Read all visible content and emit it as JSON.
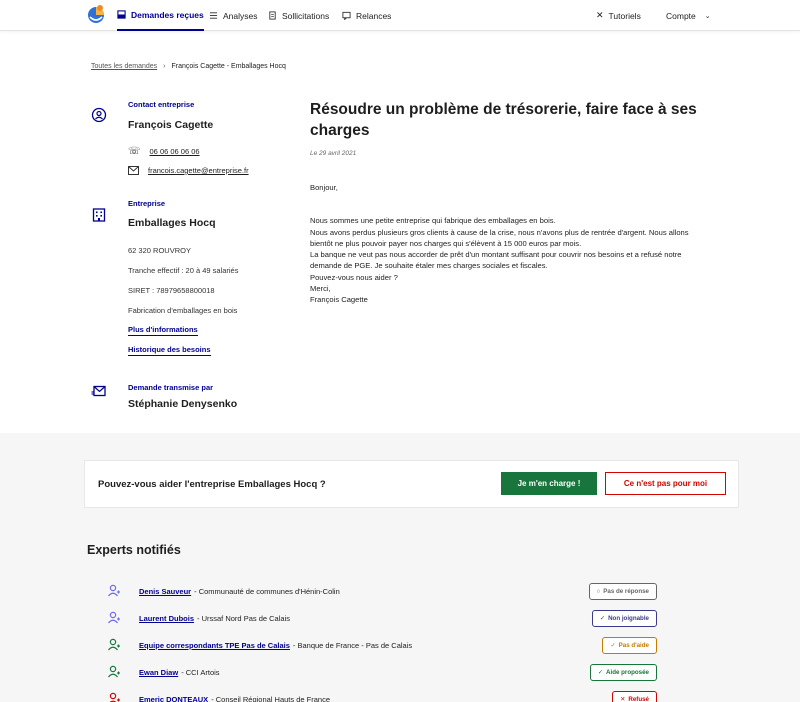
{
  "nav": {
    "items": [
      {
        "label": "Demandes reçues",
        "icon": "inbox-icon",
        "active": true
      },
      {
        "label": "Analyses",
        "icon": "list-icon",
        "active": false
      },
      {
        "label": "Sollicitations",
        "icon": "document-icon",
        "active": false
      },
      {
        "label": "Relances",
        "icon": "chat-icon",
        "active": false
      }
    ],
    "tutoriels": "Tutoriels",
    "compte": "Compte"
  },
  "breadcrumb": {
    "root": "Toutes les demandes",
    "current": "François Cagette - Emballages Hocq"
  },
  "contact": {
    "label": "Contact entreprise",
    "name": "François Cagette",
    "phone": "06 06 06 06 06",
    "email": "francois.cagette@entreprise.fr"
  },
  "company": {
    "label": "Entreprise",
    "name": "Emballages Hocq",
    "city": "62 320 ROUVROY",
    "staff": "Tranche effectif : 20 à 49 salariés",
    "siret": "SIRET : 78979658800018",
    "activity": "Fabrication d'emballages en bois",
    "more_link": "Plus d'informations",
    "history_link": "Historique des besoins"
  },
  "transmitted": {
    "label": "Demande transmise par",
    "name": "Stéphanie Denysenko"
  },
  "request": {
    "title": "Résoudre un problème de trésorerie, faire face à ses charges",
    "date": "Le 29 avril 2021",
    "greeting": "Bonjour,",
    "line1": "Nous sommes une petite entreprise qui fabrique des emballages en bois.",
    "line2": "Nous avons perdus plusieurs gros clients à cause de la crise, nous n'avons plus de rentrée d'argent. Nous allons bientôt ne plus pouvoir payer nos charges qui s'élèvent à 15 000 euros par mois.",
    "line3": "La banque ne veut pas nous accorder de prêt d'un montant suffisant pour couvrir nos besoins et a refusé notre demande de PGE. Je souhaite étaler mes charges sociales et fiscales.",
    "line4": "Pouvez-vous nous aider ?",
    "line5": "Merci,",
    "signature": "François Cagette"
  },
  "help": {
    "question": "Pouvez-vous aider l'entreprise Emballages Hocq ?",
    "accept": "Je m'en charge !",
    "refuse": "Ce n'est pas pour moi"
  },
  "experts": {
    "title": "Experts notifiés",
    "rows": [
      {
        "name": "Denis Sauveur",
        "org": "- Communauté de communes d'Hénin-Colin",
        "status": "Pas de réponse",
        "color": "#666666",
        "icon_color": "#6a6af4"
      },
      {
        "name": "Laurent Dubois",
        "org": "- Urssaf Nord Pas de Calais",
        "status": "Non joignable",
        "color": "#3a3a8c",
        "icon_color": "#6a6af4"
      },
      {
        "name": "Equipe correspondants TPE Pas de Calais",
        "org": "- Banque de France - Pas de Calais",
        "status": "Pas d'aide",
        "color": "#c77a00",
        "icon_color": "#18753c"
      },
      {
        "name": "Ewan Diaw",
        "org": "- CCI Artois",
        "status": "Aide proposée",
        "color": "#18753c",
        "icon_color": "#18753c"
      },
      {
        "name": "Emeric DONTEAUX",
        "org": "- Conseil Régional Hauts de France",
        "status": "Refusé",
        "color": "#ce0500",
        "icon_color": "#ce0500"
      }
    ]
  }
}
